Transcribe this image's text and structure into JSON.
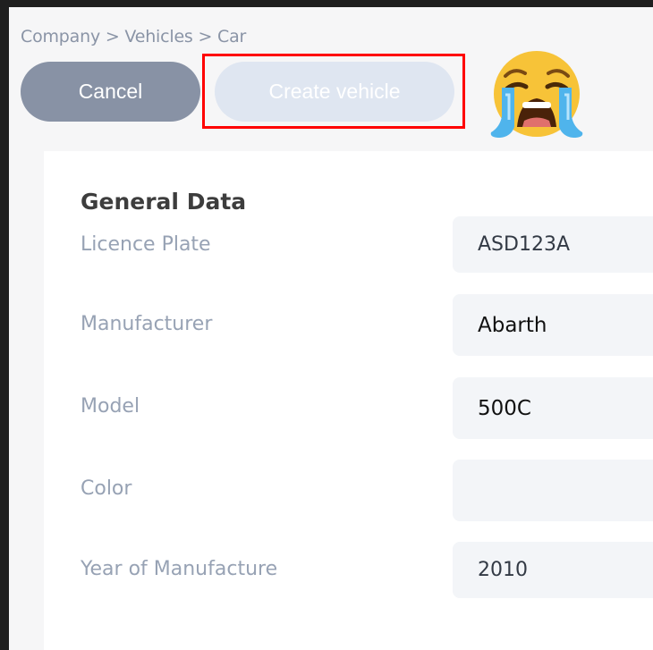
{
  "breadcrumb": "Company > Vehicles > Car",
  "actions": {
    "cancel_label": "Cancel",
    "create_label": "Create vehicle"
  },
  "annotation": {
    "highlight_color": "#ff0000",
    "emoji": "loudly-crying-face"
  },
  "form": {
    "section_title": "General Data",
    "fields": [
      {
        "label": "Licence Plate",
        "value": "ASD123A"
      },
      {
        "label": "Manufacturer",
        "value": "Abarth"
      },
      {
        "label": "Model",
        "value": "500C"
      },
      {
        "label": "Color",
        "value": ""
      },
      {
        "label": "Year of Manufacture",
        "value": "2010"
      }
    ]
  },
  "colors": {
    "button_primary_disabled": "#dfe6f1",
    "button_secondary": "#8892a5",
    "label": "#97a2b4"
  }
}
